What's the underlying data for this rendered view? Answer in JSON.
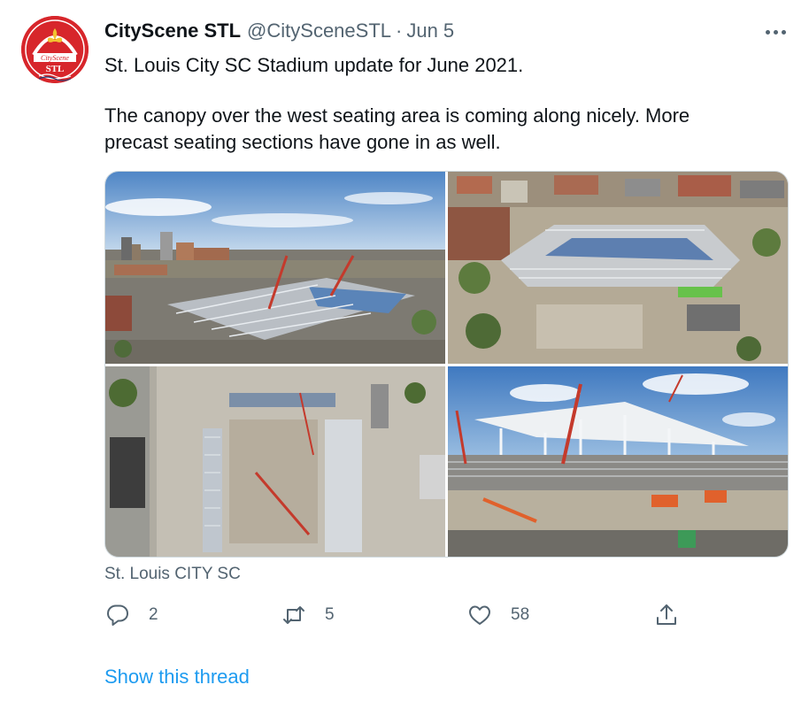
{
  "tweet": {
    "display_name": "CityScene STL",
    "handle": "@CitySceneSTL",
    "separator": "·",
    "date": "Jun 5",
    "avatar_top_text": "CityScene",
    "avatar_bottom_text": "STL",
    "text_line1": "St. Louis City SC Stadium update for June 2021.",
    "text_line2": "The canopy over the west seating area is coming along nicely. More",
    "text_line3": "precast seating sections have gone in as well.",
    "media_caption": "St. Louis CITY SC",
    "photo_count": 4
  },
  "actions": {
    "reply_count": "2",
    "retweet_count": "5",
    "like_count": "58"
  },
  "thread_link_label": "Show this thread",
  "colors": {
    "text_primary": "#0f1419",
    "text_secondary": "#536471",
    "link": "#1d9bf0",
    "avatar_red": "#d7262b",
    "border": "#cfd9de"
  },
  "icons": [
    "more-icon",
    "reply-icon",
    "retweet-icon",
    "like-icon",
    "share-icon",
    "fleur-de-lis-icon"
  ]
}
